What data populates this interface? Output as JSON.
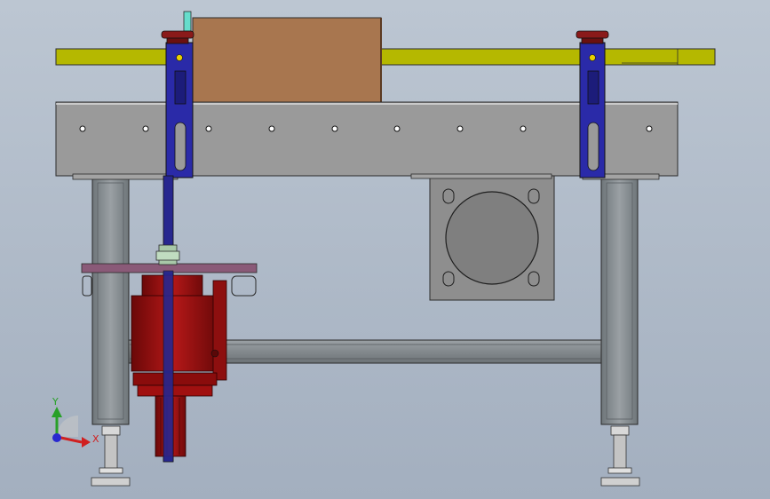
{
  "viewport": {
    "background_top": "#bcc6d2",
    "background_bottom": "#a3afbf"
  },
  "colors": {
    "frame_steel": "#8b9195",
    "conveyor_body": "#9a9a9a",
    "guide_rail": "#b5b800",
    "box": "#a8764f",
    "bracket_blue": "#2a2aa8",
    "knob_red": "#8a1a1a",
    "motor_red": "#a01010",
    "mount_plate_purple": "#8a5a78",
    "coupling_green": "#a8c8a8",
    "motor_plate_grey": "#8a8a8a",
    "axis_y_green": "#28a028",
    "axis_x_red": "#d02020",
    "axis_z_blue": "#2828d0"
  },
  "triad": {
    "y_label": "Y",
    "x_label": "X"
  }
}
